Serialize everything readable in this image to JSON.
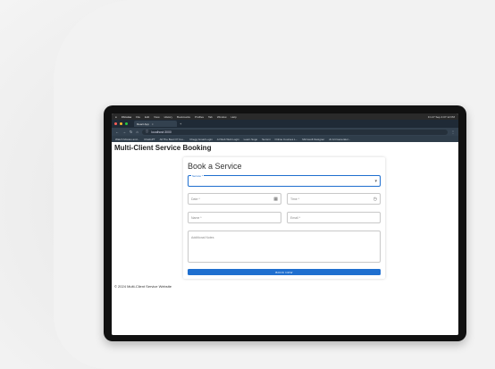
{
  "menubar": {
    "app": "Chrome",
    "items": [
      "File",
      "Edit",
      "View",
      "History",
      "Bookmarks",
      "Profiles",
      "Tab",
      "Window",
      "Help"
    ],
    "clock": "Fri 27 Sep 4:07:12 PM"
  },
  "tab": {
    "title": "React App",
    "close": "×",
    "new_tab": "+"
  },
  "address": {
    "url": "localhost:3000",
    "back": "←",
    "forward": "→",
    "reload": "↻",
    "home": "⌂"
  },
  "bookmarks": [
    "Watch Movies and...",
    "ChatGPT",
    "All The Best Of You...",
    "Chegg Gmail Login",
    "AI Web Web Login",
    "Learn Sugo",
    "Semmi",
    "Online Courses L...",
    "Microsoft Designer",
    "AI Art Generator..."
  ],
  "page": {
    "title": "Multi-Client Service Booking",
    "footer": "© 2024 Multi-Client Service Website"
  },
  "form": {
    "heading": "Book a Service",
    "service_label": "Service *",
    "date_placeholder": "Date *",
    "time_placeholder": "Time *",
    "name_placeholder": "Name *",
    "email_placeholder": "Email *",
    "notes_placeholder": "Additional Notes",
    "submit_label": "BOOK NOW"
  },
  "colors": {
    "accent": "#1f6fcf",
    "browser_chrome": "#33414f"
  },
  "icons": {
    "dropdown": "chevron-down-icon",
    "date": "calendar-icon",
    "time": "clock-icon"
  }
}
